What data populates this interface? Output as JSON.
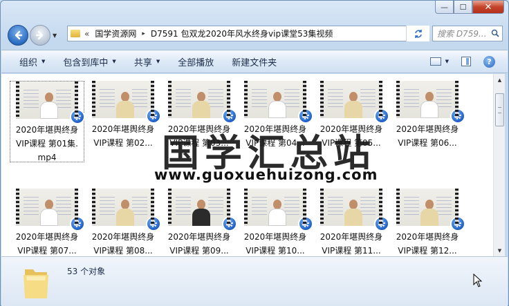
{
  "window": {
    "minimize_label": "—",
    "maximize_label": "☐",
    "close_label": "✕"
  },
  "address": {
    "chevrons": "«",
    "crumbs": [
      "国学资源网",
      "D7591 包双龙2020年风水终身vip课堂53集视频"
    ],
    "separator": "▸"
  },
  "search": {
    "placeholder": "搜索 D759..."
  },
  "toolbar": {
    "organize": "组织",
    "include_in_library": "包含到库中",
    "share": "共享",
    "play_all": "全部播放",
    "new_folder": "新建文件夹"
  },
  "files": [
    {
      "line1": "2020年堪舆终身",
      "line2": "VIP课程 第01集.",
      "line3": "mp4",
      "selected": true,
      "shirt": "#ffffff"
    },
    {
      "line1": "2020年堪舆终身",
      "line2": "VIP课程 第02...",
      "line3": "",
      "selected": false,
      "shirt": "#e8d7a6"
    },
    {
      "line1": "2020年堪舆终身",
      "line2": "VIP课程 第03...",
      "line3": "",
      "selected": false,
      "shirt": "#e8d7a6"
    },
    {
      "line1": "2020年堪舆终身",
      "line2": "VIP课程 第04...",
      "line3": "",
      "selected": false,
      "shirt": "#ffffff"
    },
    {
      "line1": "2020年堪舆终身",
      "line2": "VIP课程 第05...",
      "line3": "",
      "selected": false,
      "shirt": "#e8d7a6"
    },
    {
      "line1": "2020年堪舆终身",
      "line2": "VIP课程 第06...",
      "line3": "",
      "selected": false,
      "shirt": "#ffffff"
    },
    {
      "line1": "2020年堪舆终身",
      "line2": "VIP课程 第07...",
      "line3": "",
      "selected": false,
      "shirt": "#ffffff"
    },
    {
      "line1": "2020年堪舆终身",
      "line2": "VIP课程 第08...",
      "line3": "",
      "selected": false,
      "shirt": "#e8d7a6"
    },
    {
      "line1": "2020年堪舆终身",
      "line2": "VIP课程 第09...",
      "line3": "",
      "selected": false,
      "shirt": "#2b2b2b"
    },
    {
      "line1": "2020年堪舆终身",
      "line2": "VIP课程 第10...",
      "line3": "",
      "selected": false,
      "shirt": "#ffffff"
    },
    {
      "line1": "2020年堪舆终身",
      "line2": "VIP课程 第11...",
      "line3": "",
      "selected": false,
      "shirt": "#e8d7a6"
    },
    {
      "line1": "2020年堪舆终身",
      "line2": "VIP课程 第12...",
      "line3": "",
      "selected": false,
      "shirt": "#e8d7a6"
    }
  ],
  "watermark": {
    "chinese": "国学汇总站",
    "url": "www.guoxuehuizong.com"
  },
  "details": {
    "count": "53 个对象"
  }
}
